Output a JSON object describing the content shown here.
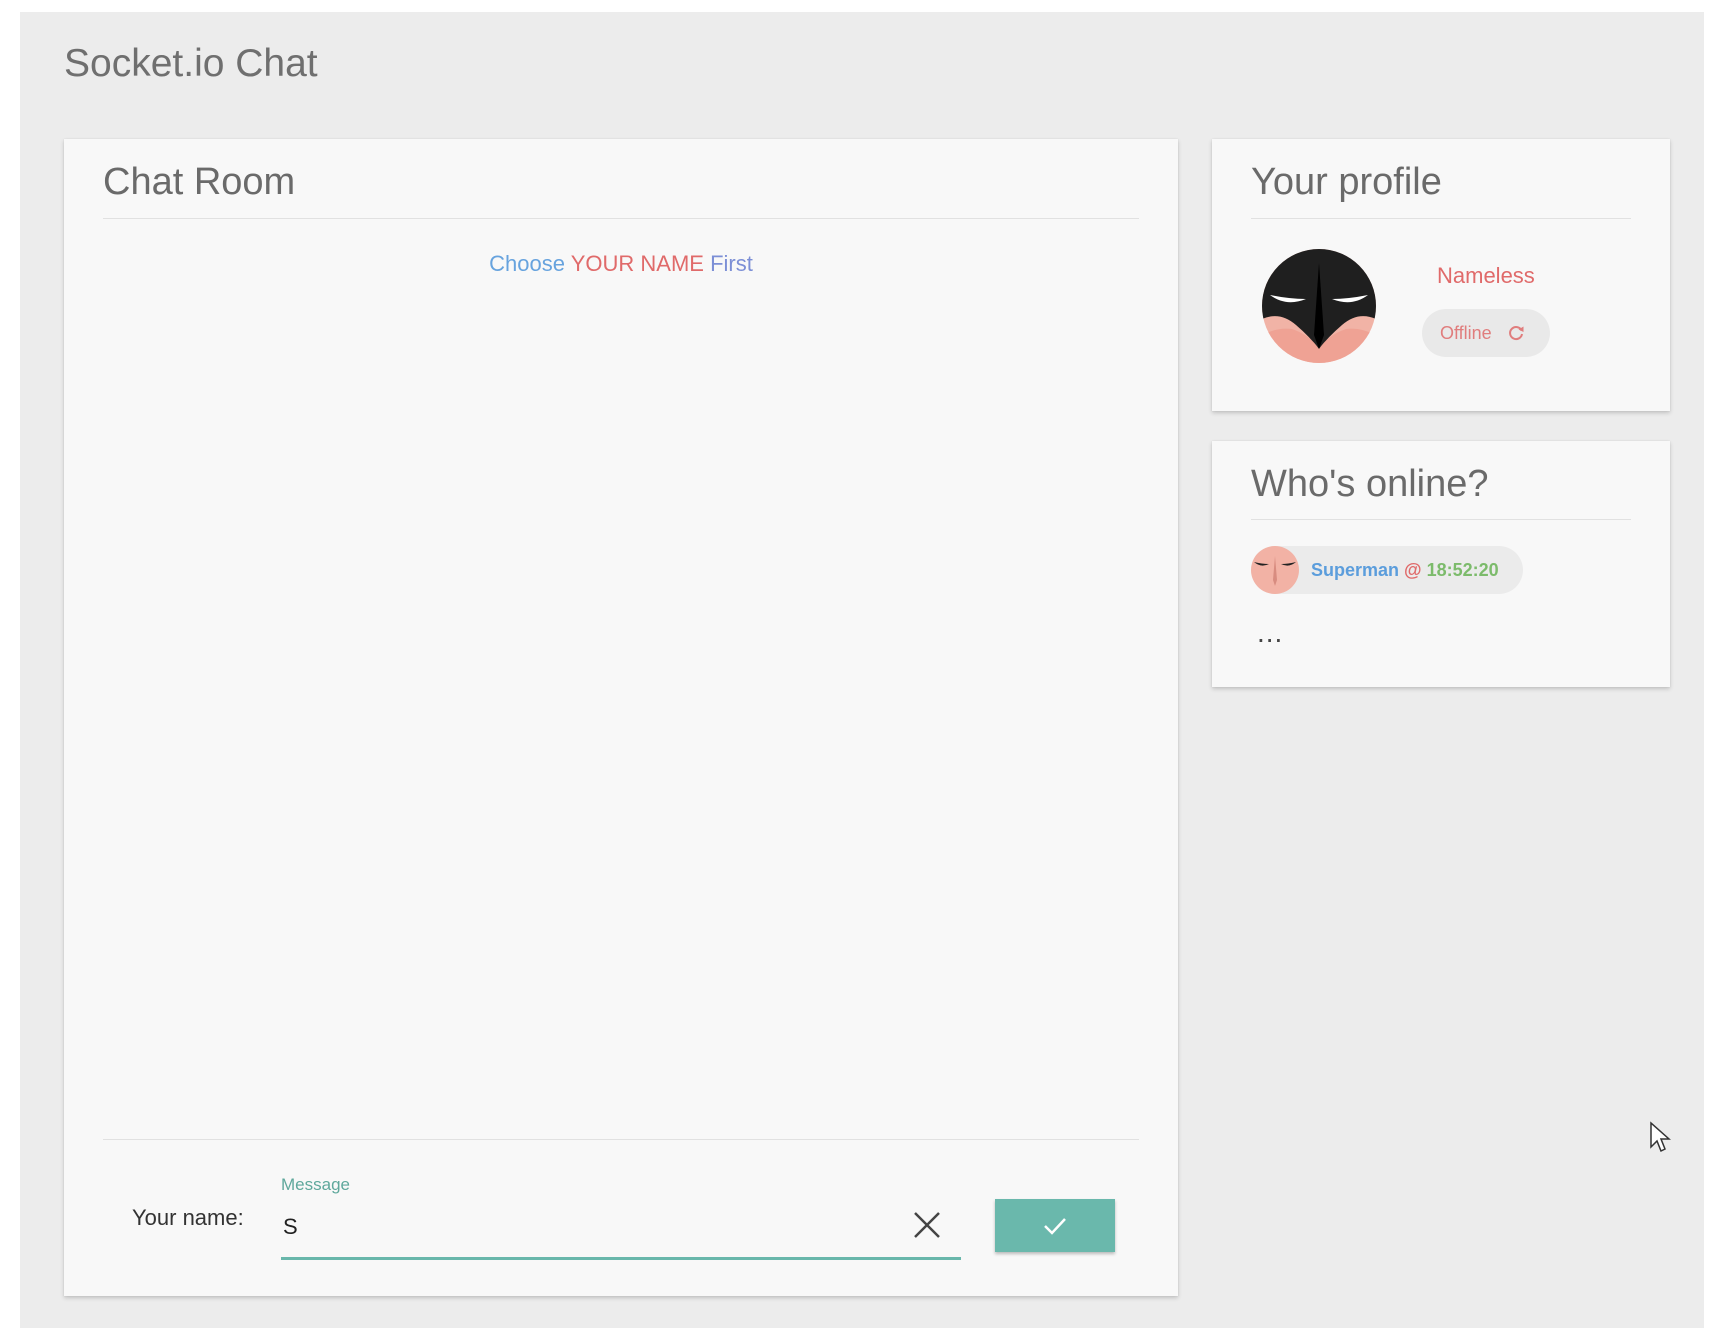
{
  "app": {
    "title": "Socket.io Chat"
  },
  "chat": {
    "title": "Chat Room",
    "hint": {
      "part1": "Choose",
      "part2": "YOUR NAME",
      "part3": "First"
    },
    "name_label": "Your name:",
    "field_label": "Message",
    "input_value": "S",
    "clear_icon": "close-icon",
    "send_icon": "check-icon"
  },
  "profile": {
    "title": "Your profile",
    "name": "Nameless",
    "status": "Offline",
    "status_icon": "refresh-icon",
    "avatar_icon": "batman-mask-avatar"
  },
  "online": {
    "title": "Who's online?",
    "users": [
      {
        "name": "Superman",
        "at": "@",
        "time": "18:52:20"
      }
    ],
    "more": "..."
  },
  "colors": {
    "accent": "#6ab8ac",
    "name_red": "#e06a6a",
    "link_blue": "#67a3de",
    "time_green": "#7cbb6b"
  }
}
